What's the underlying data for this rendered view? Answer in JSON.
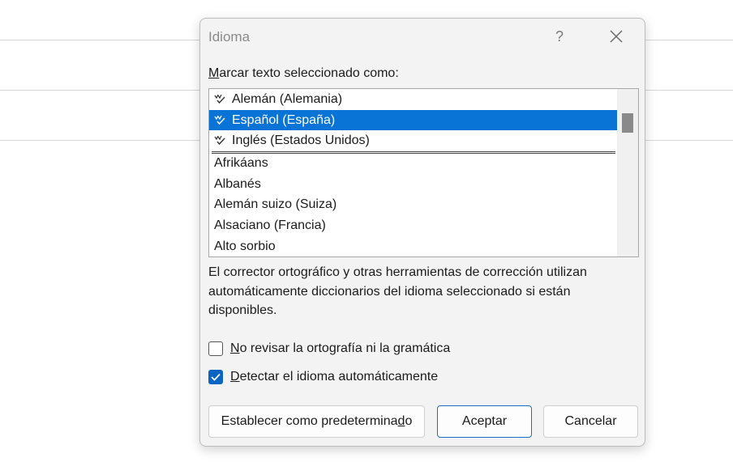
{
  "dialog": {
    "title": "Idioma",
    "help_label": "?",
    "list_label": "Marcar texto seleccionado como:",
    "recent_languages": [
      "Alemán (Alemania)",
      "Español (España)",
      "Inglés (Estados Unidos)"
    ],
    "selected_language": "Español (España)",
    "languages": [
      "Afrikáans",
      "Albanés",
      "Alemán suizo (Suiza)",
      "Alsaciano (Francia)",
      "Alto sorbio"
    ],
    "description": "El corrector ortográfico y otras herramientas de corrección utilizan automáticamente diccionarios del idioma seleccionado si están disponibles.",
    "options": {
      "no_check": {
        "label": "No revisar la ortografía ni la gramática",
        "checked": false
      },
      "auto_detect": {
        "label": "Detectar el idioma automáticamente",
        "checked": true
      }
    },
    "buttons": {
      "default": "Establecer como predeterminado",
      "accept": "Aceptar",
      "cancel": "Cancelar"
    },
    "accent_color": "#0a74d6"
  }
}
